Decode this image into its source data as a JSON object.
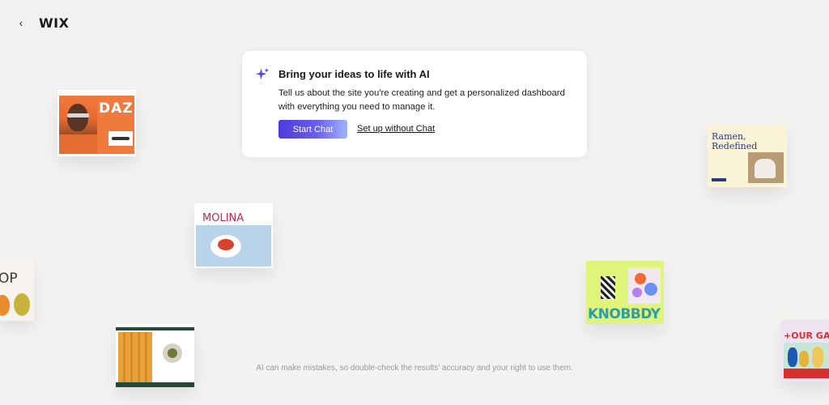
{
  "header": {
    "back_icon": "chevron-left-icon",
    "logo": "WIX"
  },
  "ai_card": {
    "icon": "sparkle-icon",
    "title": "Bring your ideas to life with AI",
    "description": "Tell us about the site you're creating and get a personalized dashboard with everything you need to manage it.",
    "start_label": "Start Chat",
    "setup_label": "Set up without Chat",
    "accent": "#4e39d6"
  },
  "thumbnails": {
    "dazi": "DAZI",
    "molina": "MOLINA",
    "op": "OP",
    "ramen": "Ramen, Redefined",
    "knobbdy": "KNOBBDY",
    "gallery": "+OUR GALL"
  },
  "disclaimer": "AI can make mistakes, so double-check the results' accuracy and your right to use them."
}
